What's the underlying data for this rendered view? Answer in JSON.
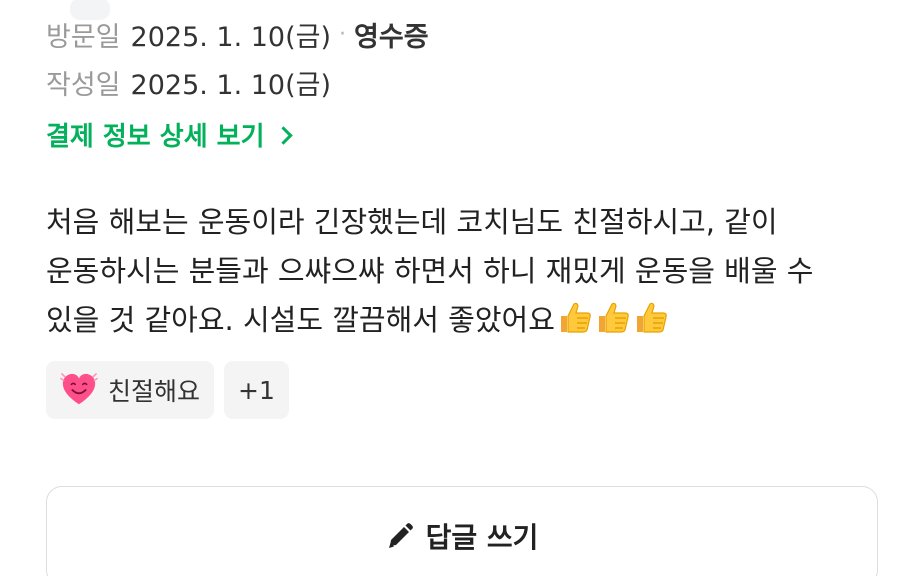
{
  "visit": {
    "label": "방문일",
    "date": "2025. 1. 10(금)",
    "separator": "·",
    "receipt": "영수증"
  },
  "written": {
    "label": "작성일",
    "date": "2025. 1. 10(금)"
  },
  "detail_link": {
    "label": "결제 정보 상세 보기"
  },
  "review": {
    "text": "처음 해보는 운동이라 긴장했는데 코치님도 친절하시고, 같이 운동하시는 분들과 으쌰으쌰 하면서 하니 재밌게 운동을 배울 수 있을 것 같아요. 시설도 깔끔해서 좋았어요",
    "emoji_icon": "thumbs-up-icon",
    "emoji_count": 3
  },
  "chips": {
    "kind_label": "친절해요",
    "kind_icon": "smiling-heart-icon",
    "more_label": "+1"
  },
  "reply_button": {
    "label": "답글 쓰기",
    "icon": "pencil-icon"
  },
  "colors": {
    "accent_green": "#03b15b",
    "muted_text": "#9a9a9a",
    "chip_bg": "#f4f4f4",
    "border": "#dedede"
  }
}
